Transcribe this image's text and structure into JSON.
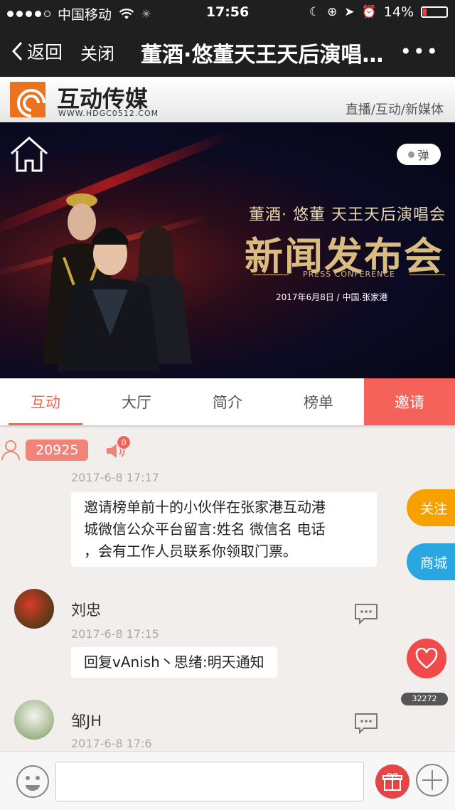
{
  "status_bar": {
    "carrier": "中国移动",
    "time": "17:56",
    "battery": "14%"
  },
  "nav": {
    "back_label": "返回",
    "close_label": "关闭",
    "title": "董酒·悠董天王天后演唱会新闻发布会",
    "more_label": "•••"
  },
  "brand": {
    "name": "互动传媒",
    "url": "WWW.HDGC0512.COM",
    "tagline": "直播/互动/新媒体"
  },
  "banner": {
    "danmu_label": "弹",
    "subtitle": "董酒·  悠董  天王天后演唱会",
    "main_title": "新闻发布会",
    "conference": "PRESS CONFERENCE",
    "date_place": "2017年6月8日  /  中国.张家港"
  },
  "tabs": [
    {
      "label": "互动",
      "active": true
    },
    {
      "label": "大厅",
      "active": false
    },
    {
      "label": "简介",
      "active": false
    },
    {
      "label": "榜单",
      "active": false
    },
    {
      "label": "邀请",
      "active": false
    }
  ],
  "online": {
    "count": "20925",
    "badge": "0"
  },
  "messages": [
    {
      "timestamp": "2017-6-8 17:17",
      "text_lines": [
        "邀请榜单前十的小伙伴在张家港互动港",
        "城微信公众平台留言:姓名 微信名 电话",
        "，会有工作人员联系你领取门票。"
      ]
    },
    {
      "user": "刘忠",
      "timestamp": "2017-6-8 17:15",
      "text": "回复vAnish丶思绪:明天通知"
    },
    {
      "user": "邹JH",
      "timestamp": "2017-6-8 17:6"
    }
  ],
  "floating": {
    "follow_label": "关注",
    "follow_color": "#f5a100",
    "mall_label": "商城",
    "mall_color": "#2aa6e0",
    "likes_count": "32272"
  },
  "colors": {
    "accent": "#f06a5a",
    "invite_bg": "#f5625a",
    "status_bg": "#1f1f1f"
  }
}
